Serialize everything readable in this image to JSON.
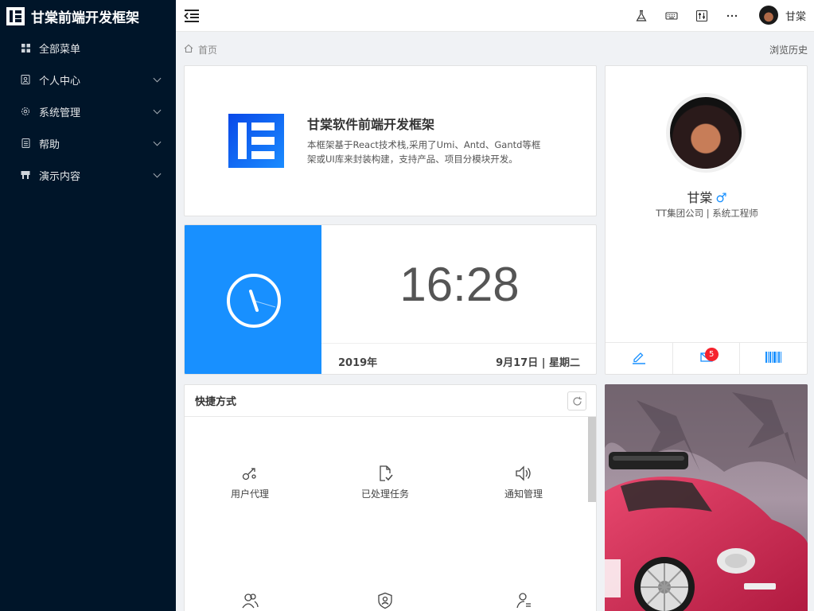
{
  "app": {
    "title": "甘棠前端开发框架"
  },
  "sidebar": {
    "items": [
      {
        "label": "全部菜单",
        "icon": "grid-icon",
        "has_children": false
      },
      {
        "label": "个人中心",
        "icon": "user-card-icon",
        "has_children": true
      },
      {
        "label": "系统管理",
        "icon": "gear-icon",
        "has_children": true
      },
      {
        "label": "帮助",
        "icon": "document-icon",
        "has_children": true
      },
      {
        "label": "演示内容",
        "icon": "flag-icon",
        "has_children": true
      }
    ]
  },
  "header": {
    "user_name": "甘棠",
    "icons": [
      "flask-icon",
      "keyboard-icon",
      "sliders-icon",
      "more-icon"
    ]
  },
  "breadcrumb": {
    "home": "首页",
    "history": "浏览历史"
  },
  "intro": {
    "title": "甘棠软件前端开发框架",
    "description": "本框架基于React技术栈,采用了Umi、Antd、Gantd等框架或UI库来封装构建，支持产品、项目分模块开发。"
  },
  "clock": {
    "time": "16:28",
    "year": "2019年",
    "date": "9月17日 | 星期二"
  },
  "profile": {
    "name": "甘棠",
    "gender_symbol": "♂",
    "org": "TT集团公司 | 系统工程师",
    "message_count": "5"
  },
  "shortcuts": {
    "title": "快捷方式",
    "items": [
      {
        "label": "用户代理",
        "icon": "proxy-icon"
      },
      {
        "label": "已处理任务",
        "icon": "file-check-icon"
      },
      {
        "label": "通知管理",
        "icon": "sound-icon"
      },
      {
        "label": "",
        "icon": "team-icon"
      },
      {
        "label": "",
        "icon": "shield-user-icon"
      },
      {
        "label": "",
        "icon": "user-list-icon"
      }
    ]
  },
  "colors": {
    "sidebar": "#001529",
    "accent": "#1890ff",
    "badge": "#f5222d"
  }
}
